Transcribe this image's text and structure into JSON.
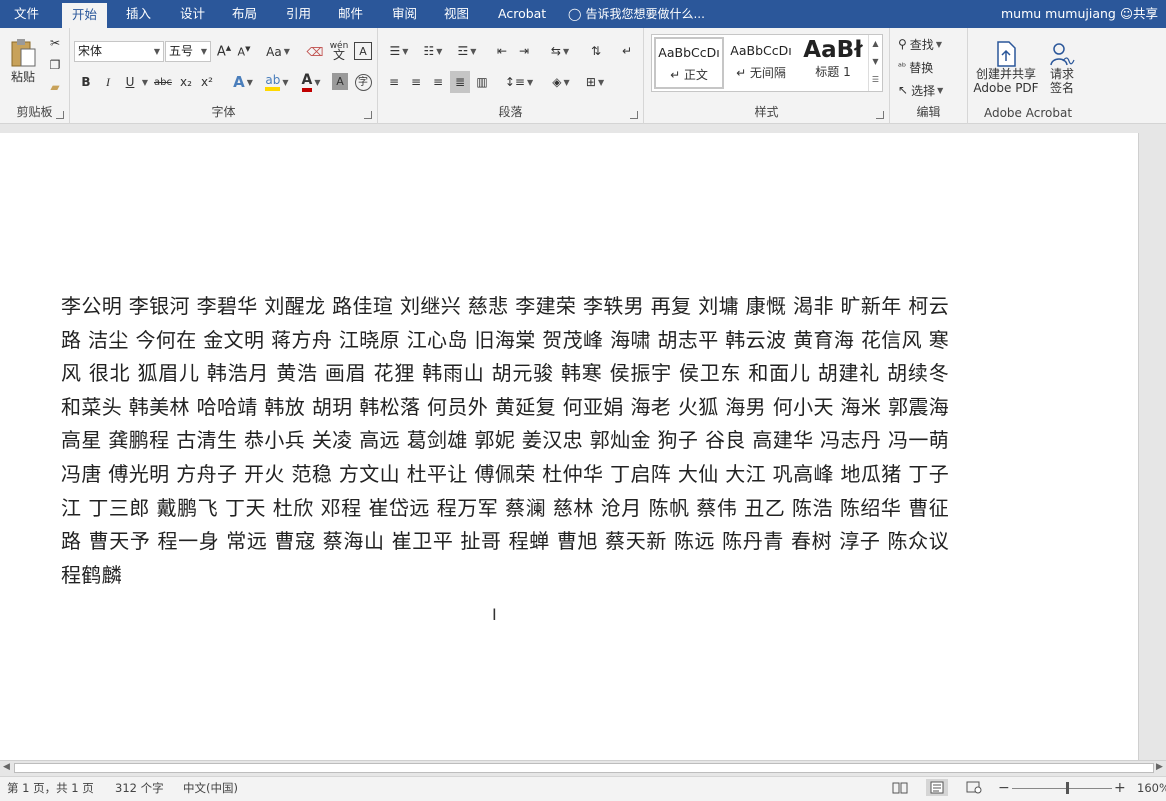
{
  "tabs": {
    "file": "文件",
    "home": "开始",
    "insert": "插入",
    "design": "设计",
    "layout": "布局",
    "references": "引用",
    "mailings": "邮件",
    "review": "审阅",
    "view": "视图",
    "acrobat": "Acrobat"
  },
  "tell_me": "告诉我您想要做什么...",
  "user_name": "mumu mumujiang",
  "share_label": "共享",
  "ribbon": {
    "clipboard": {
      "paste": "粘贴",
      "group": "剪贴板"
    },
    "font": {
      "font_name": "宋体",
      "font_size": "五号",
      "change_case": "Aa",
      "phonetic": "wén",
      "bold": "B",
      "italic": "I",
      "underline": "U",
      "strike": "abc",
      "subscript": "x₂",
      "superscript": "x²",
      "group": "字体"
    },
    "paragraph": {
      "group": "段落"
    },
    "styles": {
      "items": [
        {
          "sample": "AaBbCcDı",
          "name": "↵ 正文"
        },
        {
          "sample": "AaBbCcDı",
          "name": "↵ 无间隔"
        },
        {
          "sample": "AaBł",
          "name": "标题 1"
        }
      ],
      "group": "样式"
    },
    "editing": {
      "find": "查找",
      "replace": "替换",
      "select": "选择",
      "group": "编辑"
    },
    "acrobat": {
      "create_share": "创建并共享",
      "adobe_pdf": "Adobe PDF",
      "request": "请求",
      "sign": "签名",
      "group": "Adobe Acrobat"
    }
  },
  "document": {
    "text": "李公明 李银河 李碧华 刘醒龙 路佳瑄 刘继兴 慈悲 李建荣 李轶男 再复 刘墉 康慨 渴非 旷新年 柯云路 洁尘 今何在 金文明 蒋方舟 江晓原 江心岛 旧海棠 贺茂峰 海啸 胡志平 韩云波 黄育海 花信风 寒风 很北 狐眉儿 韩浩月 黄浩 画眉 花狸 韩雨山 胡元骏 韩寒 侯振宇 侯卫东 和面儿 胡建礼 胡续冬 和菜头 韩美林 哈哈靖 韩放 胡玥 韩松落 何员外 黄延复 何亚娟 海老 火狐 海男 何小天 海米 郭震海 高星 龚鹏程 古清生 恭小兵 关凌 高远 葛剑雄 郭妮 姜汉忠 郭灿金 狗子 谷良 高建华 冯志丹 冯一萌 冯唐 傅光明 方舟子 开火 范稳 方文山 杜平让 傅佩荣 杜仲华 丁启阵 大仙 大江 巩高峰 地瓜猪 丁子江 丁三郎 戴鹏飞 丁天 杜欣 邓程 崔岱远 程万军 蔡澜 慈林 沧月 陈帆 蔡伟 丑乙 陈浩 陈绍华 曹征路 曹天予 程一身 常远 曹寇 蔡海山 崔卫平 扯哥 程蝉 曹旭 蔡天新 陈远 陈丹青 春树 淳子 陈众议 程鹤麟"
  },
  "status": {
    "page": "第 1 页，共 1 页",
    "words": "312 个字",
    "language": "中文(中国)",
    "zoom": "160%"
  }
}
